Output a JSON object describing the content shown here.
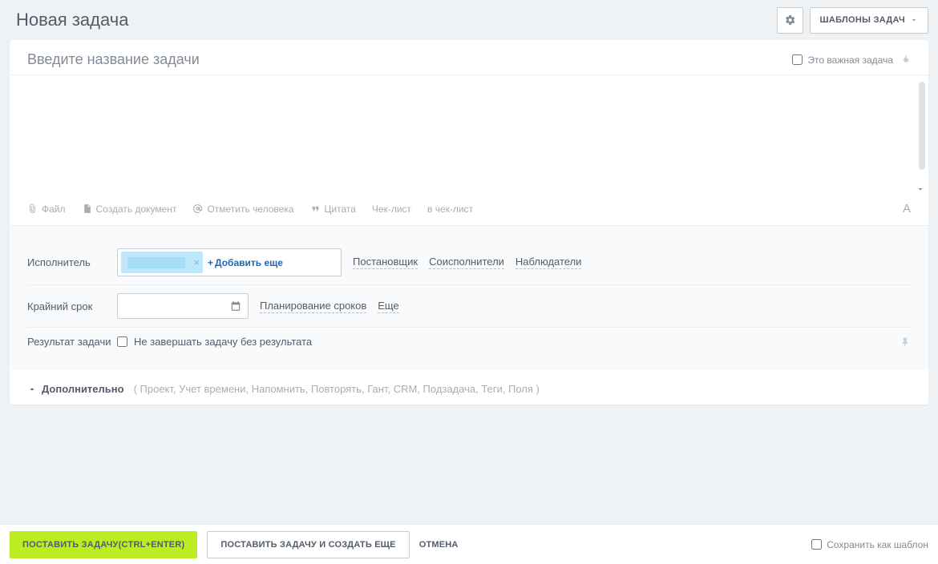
{
  "page": {
    "title": "Новая задача"
  },
  "header": {
    "templates_button": "ШАБЛОНЫ ЗАДАЧ"
  },
  "task": {
    "title_placeholder": "Введите название задачи",
    "important_label": "Это важная задача"
  },
  "toolbar": {
    "file": "Файл",
    "create_doc": "Создать документ",
    "mention": "Отметить человека",
    "quote": "Цитата",
    "checklist": "Чек-лист",
    "to_checklist": "в чек-лист"
  },
  "fields": {
    "executor": {
      "label": "Исполнитель",
      "add_more": "Добавить еще",
      "roles": {
        "creator": "Постановщик",
        "participants": "Соисполнители",
        "observers": "Наблюдатели"
      }
    },
    "deadline": {
      "label": "Крайний срок",
      "planning": "Планирование сроков",
      "more": "Еще"
    },
    "result": {
      "label": "Результат задачи",
      "checkbox": "Не завершать задачу без результата"
    }
  },
  "additional": {
    "label": "Дополнительно",
    "hint": "( Проект,  Учет времени,  Напомнить,  Повторять,  Гант,  CRM,  Подзадача,  Теги,  Поля )"
  },
  "footer": {
    "submit": "ПОСТАВИТЬ ЗАДАЧУ(CTRL+ENTER)",
    "submit_and_new": "ПОСТАВИТЬ ЗАДАЧУ И СОЗДАТЬ ЕЩЕ",
    "cancel": "ОТМЕНА",
    "save_template": "Сохранить как шаблон"
  }
}
